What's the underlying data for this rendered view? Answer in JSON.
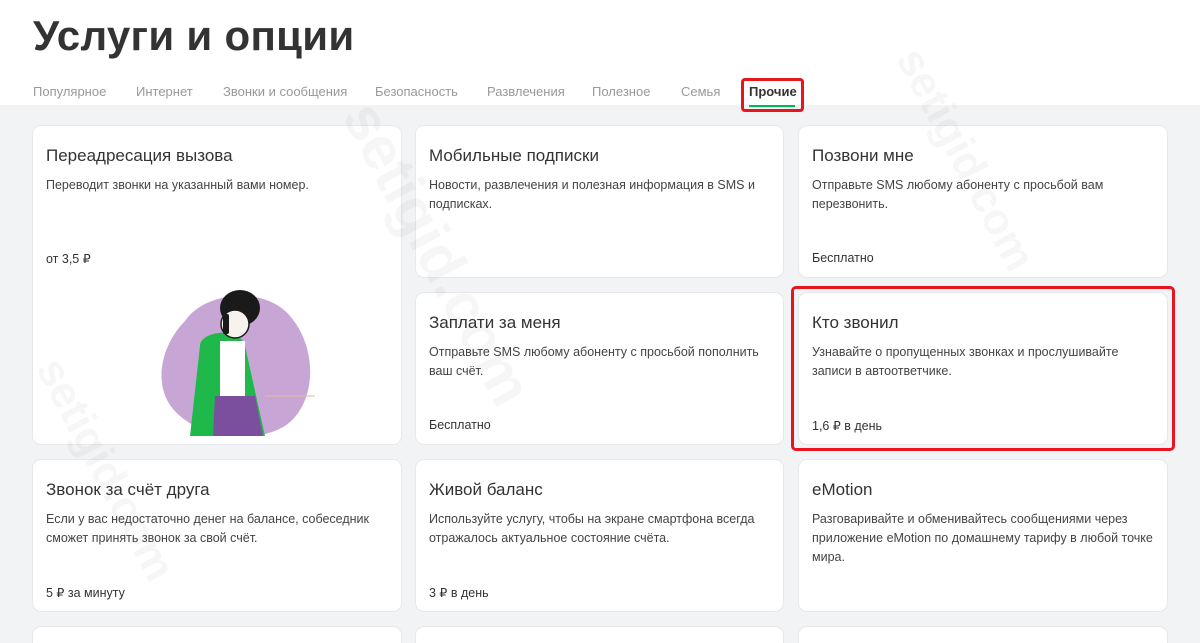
{
  "page": {
    "title": "Услуги и опции"
  },
  "tabs": [
    {
      "label": "Популярное"
    },
    {
      "label": "Интернет"
    },
    {
      "label": "Звонки и сообщения"
    },
    {
      "label": "Безопасность"
    },
    {
      "label": "Развлечения"
    },
    {
      "label": "Полезное"
    },
    {
      "label": "Семья"
    },
    {
      "label": "Прочие",
      "active": true
    }
  ],
  "cards": [
    {
      "title": "Переадресация вызова",
      "description": "Переводит звонки на указанный вами номер.",
      "price": "от 3,5 ₽"
    },
    {
      "title": "Мобильные подписки",
      "description": "Новости, развлечения и полезная информация в SMS и подписках.",
      "price": ""
    },
    {
      "title": "Позвони мне",
      "description": "Отправьте SMS любому абоненту с просьбой вам перезвонить.",
      "price": "Бесплатно"
    },
    {
      "title": "Заплати за меня",
      "description": "Отправьте SMS любому абоненту с просьбой пополнить ваш счёт.",
      "price": "Бесплатно"
    },
    {
      "title": "Кто звонил",
      "description": "Узнавайте о пропущенных звонках и прослушивайте записи в автоответчике.",
      "price": "1,6 ₽ в день",
      "highlighted": true
    },
    {
      "title": "Звонок за счёт друга",
      "description": "Если у вас недостаточно денег на балансе, собеседник сможет принять звонок за свой счёт.",
      "price": "5 ₽ за минуту"
    },
    {
      "title": "Живой баланс",
      "description": "Используйте услугу, чтобы на экране смартфона всегда отражалось актуальное состояние счёта.",
      "price": "3 ₽ в день"
    },
    {
      "title": "eMotion",
      "description": "Разговаривайте и обменивайтесь сообщениями через приложение eMotion по домашнему тарифу в любой точке мира.",
      "price": ""
    }
  ],
  "watermark": "setigid.com",
  "colors": {
    "accent_green": "#00b956",
    "highlight_red": "#e8141e",
    "illustration_purple": "#c7a6d6",
    "illustration_green": "#1fb84a"
  }
}
